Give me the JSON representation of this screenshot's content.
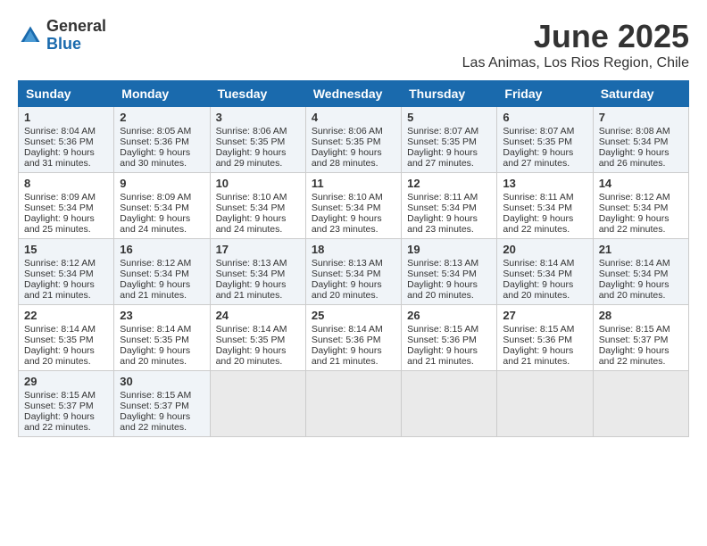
{
  "header": {
    "logo_general": "General",
    "logo_blue": "Blue",
    "month_title": "June 2025",
    "location": "Las Animas, Los Rios Region, Chile"
  },
  "weekdays": [
    "Sunday",
    "Monday",
    "Tuesday",
    "Wednesday",
    "Thursday",
    "Friday",
    "Saturday"
  ],
  "weeks": [
    [
      {
        "day": "1",
        "sunrise": "8:04 AM",
        "sunset": "5:36 PM",
        "daylight": "9 hours and 31 minutes."
      },
      {
        "day": "2",
        "sunrise": "8:05 AM",
        "sunset": "5:36 PM",
        "daylight": "9 hours and 30 minutes."
      },
      {
        "day": "3",
        "sunrise": "8:06 AM",
        "sunset": "5:35 PM",
        "daylight": "9 hours and 29 minutes."
      },
      {
        "day": "4",
        "sunrise": "8:06 AM",
        "sunset": "5:35 PM",
        "daylight": "9 hours and 28 minutes."
      },
      {
        "day": "5",
        "sunrise": "8:07 AM",
        "sunset": "5:35 PM",
        "daylight": "9 hours and 27 minutes."
      },
      {
        "day": "6",
        "sunrise": "8:07 AM",
        "sunset": "5:35 PM",
        "daylight": "9 hours and 27 minutes."
      },
      {
        "day": "7",
        "sunrise": "8:08 AM",
        "sunset": "5:34 PM",
        "daylight": "9 hours and 26 minutes."
      }
    ],
    [
      {
        "day": "8",
        "sunrise": "8:09 AM",
        "sunset": "5:34 PM",
        "daylight": "9 hours and 25 minutes."
      },
      {
        "day": "9",
        "sunrise": "8:09 AM",
        "sunset": "5:34 PM",
        "daylight": "9 hours and 24 minutes."
      },
      {
        "day": "10",
        "sunrise": "8:10 AM",
        "sunset": "5:34 PM",
        "daylight": "9 hours and 24 minutes."
      },
      {
        "day": "11",
        "sunrise": "8:10 AM",
        "sunset": "5:34 PM",
        "daylight": "9 hours and 23 minutes."
      },
      {
        "day": "12",
        "sunrise": "8:11 AM",
        "sunset": "5:34 PM",
        "daylight": "9 hours and 23 minutes."
      },
      {
        "day": "13",
        "sunrise": "8:11 AM",
        "sunset": "5:34 PM",
        "daylight": "9 hours and 22 minutes."
      },
      {
        "day": "14",
        "sunrise": "8:12 AM",
        "sunset": "5:34 PM",
        "daylight": "9 hours and 22 minutes."
      }
    ],
    [
      {
        "day": "15",
        "sunrise": "8:12 AM",
        "sunset": "5:34 PM",
        "daylight": "9 hours and 21 minutes."
      },
      {
        "day": "16",
        "sunrise": "8:12 AM",
        "sunset": "5:34 PM",
        "daylight": "9 hours and 21 minutes."
      },
      {
        "day": "17",
        "sunrise": "8:13 AM",
        "sunset": "5:34 PM",
        "daylight": "9 hours and 21 minutes."
      },
      {
        "day": "18",
        "sunrise": "8:13 AM",
        "sunset": "5:34 PM",
        "daylight": "9 hours and 20 minutes."
      },
      {
        "day": "19",
        "sunrise": "8:13 AM",
        "sunset": "5:34 PM",
        "daylight": "9 hours and 20 minutes."
      },
      {
        "day": "20",
        "sunrise": "8:14 AM",
        "sunset": "5:34 PM",
        "daylight": "9 hours and 20 minutes."
      },
      {
        "day": "21",
        "sunrise": "8:14 AM",
        "sunset": "5:34 PM",
        "daylight": "9 hours and 20 minutes."
      }
    ],
    [
      {
        "day": "22",
        "sunrise": "8:14 AM",
        "sunset": "5:35 PM",
        "daylight": "9 hours and 20 minutes."
      },
      {
        "day": "23",
        "sunrise": "8:14 AM",
        "sunset": "5:35 PM",
        "daylight": "9 hours and 20 minutes."
      },
      {
        "day": "24",
        "sunrise": "8:14 AM",
        "sunset": "5:35 PM",
        "daylight": "9 hours and 20 minutes."
      },
      {
        "day": "25",
        "sunrise": "8:14 AM",
        "sunset": "5:36 PM",
        "daylight": "9 hours and 21 minutes."
      },
      {
        "day": "26",
        "sunrise": "8:15 AM",
        "sunset": "5:36 PM",
        "daylight": "9 hours and 21 minutes."
      },
      {
        "day": "27",
        "sunrise": "8:15 AM",
        "sunset": "5:36 PM",
        "daylight": "9 hours and 21 minutes."
      },
      {
        "day": "28",
        "sunrise": "8:15 AM",
        "sunset": "5:37 PM",
        "daylight": "9 hours and 22 minutes."
      }
    ],
    [
      {
        "day": "29",
        "sunrise": "8:15 AM",
        "sunset": "5:37 PM",
        "daylight": "9 hours and 22 minutes."
      },
      {
        "day": "30",
        "sunrise": "8:15 AM",
        "sunset": "5:37 PM",
        "daylight": "9 hours and 22 minutes."
      },
      null,
      null,
      null,
      null,
      null
    ]
  ]
}
